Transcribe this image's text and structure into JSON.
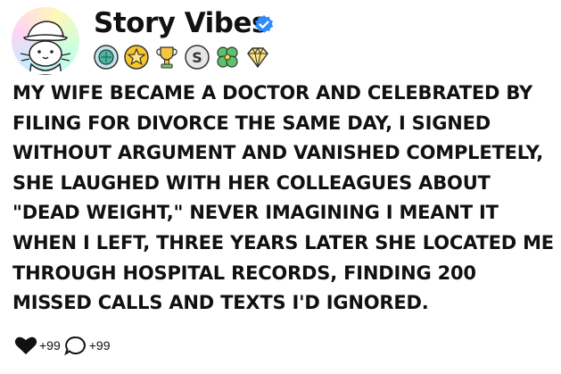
{
  "account": {
    "name": "Story Vibes",
    "verified": true
  },
  "badges": [
    "globe-badge",
    "star-badge",
    "trophy-badge",
    "s-badge",
    "clover-badge",
    "diamond-badge"
  ],
  "post": {
    "text": "MY WIFE BECAME A DOCTOR AND CELEBRATED BY FILING FOR DIVORCE THE SAME DAY, I SIGNED WITHOUT ARGUMENT AND VANISHED COMPLETELY, SHE LAUGHED WITH HER COLLEAGUES ABOUT \"DEAD WEIGHT,\" NEVER IMAGINING I MEANT IT WHEN I LEFT, THREE YEARS LATER SHE LOCATED ME THROUGH HOSPITAL RECORDS, FINDING 200 MISSED CALLS AND TEXTS I'D IGNORED."
  },
  "footer": {
    "likes": "+99",
    "comments": "+99"
  },
  "colors": {
    "verified": "#2f8cff",
    "text": "#111111"
  }
}
